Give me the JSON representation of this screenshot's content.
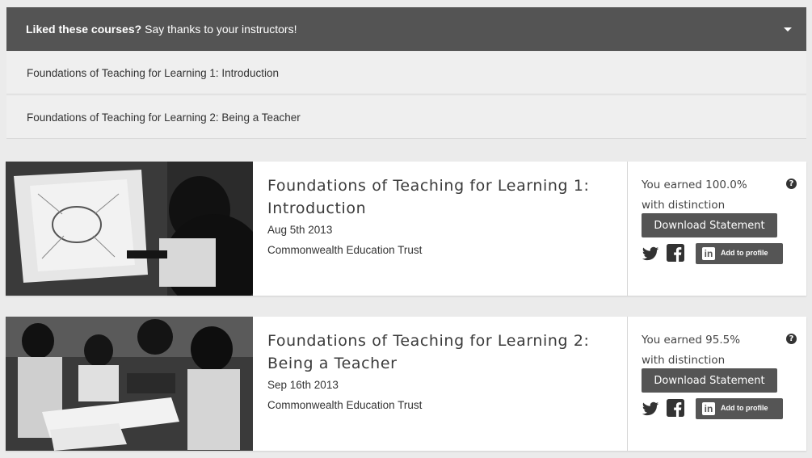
{
  "banner": {
    "bold": "Liked these courses?",
    "text": "Say thanks to your instructors!"
  },
  "course_links": [
    "Foundations of Teaching for Learning 1: Introduction",
    "Foundations of Teaching for Learning 2: Being a Teacher"
  ],
  "cards": [
    {
      "title": "Foundations of Teaching for Learning 1: Introduction",
      "date": "Aug 5th 2013",
      "org": "Commonwealth Education Trust",
      "grade_line1": "You earned 100.0%",
      "grade_line2": "with distinction",
      "download_label": "Download Statement",
      "linkedin_label": "Add to profile"
    },
    {
      "title": "Foundations of Teaching for Learning 2: Being a Teacher",
      "date": "Sep 16th 2013",
      "org": "Commonwealth Education Trust",
      "grade_line1": "You earned 95.5%",
      "grade_line2": "with distinction",
      "download_label": "Download Statement",
      "linkedin_label": "Add to profile"
    }
  ],
  "icons": {
    "help": "?",
    "linkedin": "in"
  }
}
